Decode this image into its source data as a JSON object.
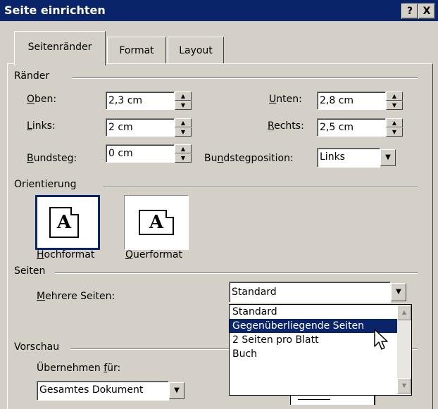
{
  "window": {
    "title": "Seite einrichten",
    "help_label": "?",
    "close_label": "X"
  },
  "tabs": [
    {
      "label": "Seitenränder",
      "active": true
    },
    {
      "label": "Format",
      "active": false
    },
    {
      "label": "Layout",
      "active": false
    }
  ],
  "margins": {
    "group_label": "Ränder",
    "oben": {
      "mnemonic": "O",
      "rest": "ben:",
      "value": "2,3 cm"
    },
    "unten": {
      "mnemonic": "U",
      "rest": "nten:",
      "value": "2,8 cm"
    },
    "links": {
      "mnemonic": "L",
      "rest": "inks:",
      "value": "2 cm"
    },
    "rechts": {
      "mnemonic": "R",
      "rest": "echts:",
      "value": "2,5 cm"
    },
    "bundsteg": {
      "mnemonic": "B",
      "rest": "undsteg:",
      "value": "0 cm"
    },
    "bundstegposition": {
      "pre": "Bu",
      "mnemonic": "n",
      "rest": "dstegposition:",
      "value": "Links"
    }
  },
  "orientation": {
    "group_label": "Orientierung",
    "icon_letter": "A",
    "portrait": {
      "mnemonic": "H",
      "rest": "ochformat"
    },
    "landscape": {
      "mnemonic": "Q",
      "rest": "uerformat"
    }
  },
  "pages": {
    "group_label": "Seiten",
    "multiple": {
      "mnemonic": "M",
      "rest": "ehrere Seiten:",
      "value": "Standard"
    },
    "options": [
      "Standard",
      "Gegenüberliegende Seiten",
      "2 Seiten pro Blatt",
      "Buch"
    ],
    "highlighted_option": "Gegenüberliegende Seiten"
  },
  "preview": {
    "group_label": "Vorschau",
    "apply_label_pre": "Übernehmen ",
    "apply_mnemonic": "f",
    "apply_label_rest": "ür:",
    "apply_value": "Gesamtes Dokument"
  },
  "colors": {
    "titlebar": "#0a246a",
    "face": "#d4d0c8",
    "highlight": "#0a246a"
  }
}
